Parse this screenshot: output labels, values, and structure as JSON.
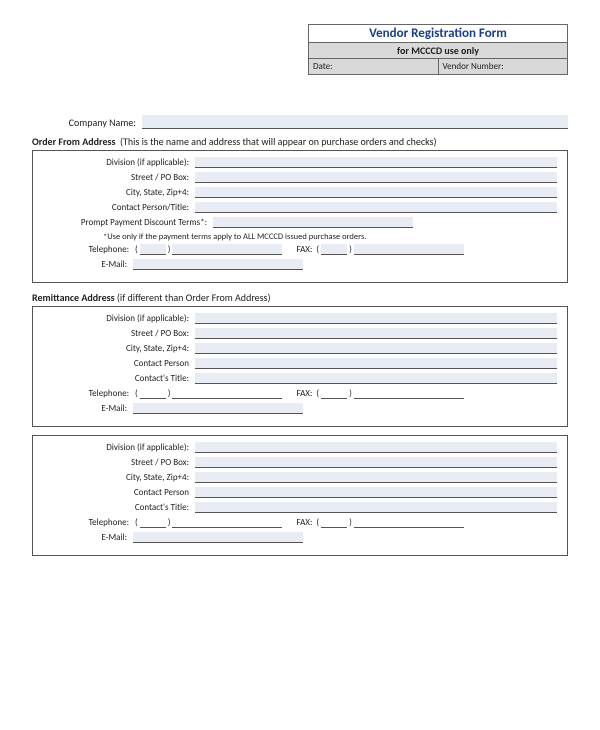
{
  "header": {
    "title": "Vendor Registration Form",
    "sub": "for MCCCD use only",
    "date_label": "Date:",
    "vendor_label": "Vendor Number:"
  },
  "company_label": "Company Name:",
  "section1": {
    "title": "Order From Address",
    "note": "(This is the name and address that will appear on purchase orders and checks)",
    "division": "Division (if applicable):",
    "street": "Street / PO Box:",
    "city": "City, State, Zip+4:",
    "contact": "Contact Person/Title:",
    "terms": "Prompt Payment Discount Terms*:",
    "terms_note": "*Use only if the payment terms apply to ALL MCCCD issued purchase orders.",
    "telephone": "Telephone:",
    "fax": "FAX:",
    "email": "E-Mail:"
  },
  "section2": {
    "title": "Remittance Address",
    "note": "(if different than Order From Address)",
    "division": "Division (if applicable):",
    "street": "Street / PO Box:",
    "city": "City, State, Zip+4:",
    "contact_person": "Contact Person",
    "contact_title": "Contact's Title:",
    "telephone": "Telephone:",
    "fax": "FAX:",
    "email": "E-Mail:"
  },
  "section3": {
    "division": "Division (if applicable):",
    "street": "Street / PO Box:",
    "city": "City, State, Zip+4:",
    "contact_person": "Contact Person",
    "contact_title": "Contact's Title:",
    "telephone": "Telephone:",
    "fax": "FAX:",
    "email": "E-Mail:"
  }
}
